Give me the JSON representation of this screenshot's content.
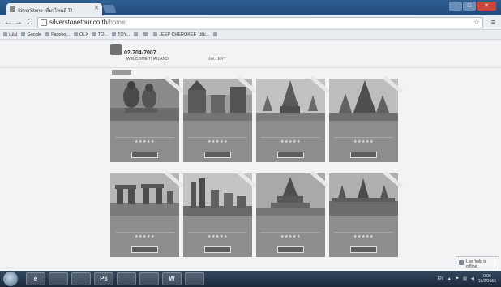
{
  "browser": {
    "tab_title": "SilverStone เที่ยวไหนดี T!",
    "tab_close": "✕",
    "window_buttons": {
      "minimize": "–",
      "maximize": "□",
      "close": "✕"
    },
    "nav": {
      "back": "←",
      "forward": "→",
      "reload": "C"
    },
    "url_host": "silverstonetour.co.th",
    "url_path": "/home",
    "star": "☆",
    "menu": "≡"
  },
  "bookmarks": [
    {
      "label": "แอป"
    },
    {
      "label": "Google"
    },
    {
      "label": "Facebo..."
    },
    {
      "label": "OLX"
    },
    {
      "label": "TO..."
    },
    {
      "label": "TOY..."
    },
    {
      "label": ""
    },
    {
      "label": ""
    },
    {
      "label": "JEEP CHEROKEE ใหม..."
    },
    {
      "label": ""
    }
  ],
  "site": {
    "name": "",
    "phone": "02-704-7007",
    "nav": [
      "",
      "WELCOME THAILAND",
      "",
      "",
      "",
      "GALLERY",
      "",
      "",
      ""
    ]
  },
  "tours": [
    {
      "title": "",
      "stars": "★★★★★",
      "duration": "",
      "more": ""
    },
    {
      "title": "",
      "stars": "★★★★★",
      "duration": "",
      "more": ""
    },
    {
      "title": "",
      "stars": "★★★★★",
      "duration": "",
      "more": ""
    },
    {
      "title": "",
      "stars": "★★★★★",
      "duration": "",
      "more": ""
    },
    {
      "title": "",
      "stars": "★★★★★",
      "duration": "",
      "more": ""
    },
    {
      "title": "",
      "stars": "★★★★★",
      "duration": "",
      "more": ""
    },
    {
      "title": "",
      "stars": "★★★★★",
      "duration": "",
      "more": ""
    },
    {
      "title": "",
      "stars": "★★★★★",
      "duration": "",
      "more": ""
    }
  ],
  "taskbar": {
    "apps": [
      "e",
      "",
      "",
      "Ps",
      "",
      "",
      "W",
      ""
    ],
    "tray_lang": "EN",
    "time": "0:06",
    "date": "18/2/2556"
  },
  "toast": {
    "line1": "Live help is",
    "line2": "offline."
  }
}
